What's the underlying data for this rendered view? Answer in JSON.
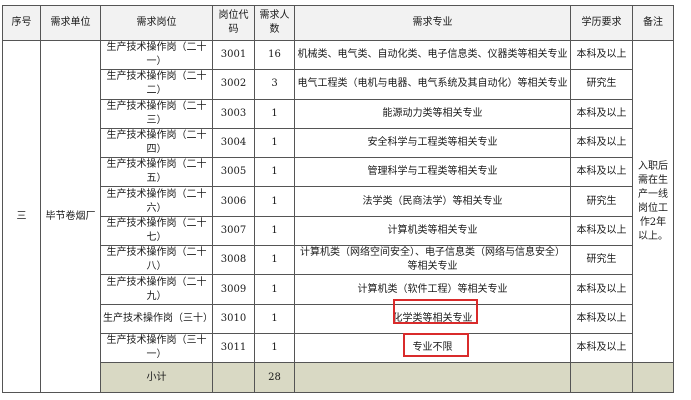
{
  "table": {
    "headers": [
      "序号",
      "需求单位",
      "需求岗位",
      "岗位代码",
      "需求人数",
      "需求专业",
      "学历要求",
      "备注"
    ],
    "seq": "三",
    "unit": "毕节卷烟厂",
    "rows": [
      {
        "post": "生产技术操作岗（二十一）",
        "code": "3001",
        "count": "16",
        "major": "机械类、电气类、自动化类、电子信息类、仪器类等相关专业",
        "edu": "本科及以上"
      },
      {
        "post": "生产技术操作岗（二十二）",
        "code": "3002",
        "count": "3",
        "major": "电气工程类（电机与电器、电气系统及其自动化）等相关专业",
        "edu": "研究生"
      },
      {
        "post": "生产技术操作岗（二十三）",
        "code": "3003",
        "count": "1",
        "major": "能源动力类等相关专业",
        "edu": "本科及以上"
      },
      {
        "post": "生产技术操作岗（二十四）",
        "code": "3004",
        "count": "1",
        "major": "安全科学与工程类等相关专业",
        "edu": "本科及以上"
      },
      {
        "post": "生产技术操作岗（二十五）",
        "code": "3005",
        "count": "1",
        "major": "管理科学与工程类等相关专业",
        "edu": "本科及以上"
      },
      {
        "post": "生产技术操作岗（二十六）",
        "code": "3006",
        "count": "1",
        "major": "法学类（民商法学）等相关专业",
        "edu": "研究生"
      },
      {
        "post": "生产技术操作岗（二十七）",
        "code": "3007",
        "count": "1",
        "major": "计算机类等相关专业",
        "edu": "本科及以上"
      },
      {
        "post": "生产技术操作岗（二十八）",
        "code": "3008",
        "count": "1",
        "major": "计算机类（网络空间安全）、电子信息类（网络与信息安全）等相关专业",
        "edu": "研究生"
      },
      {
        "post": "生产技术操作岗（二十九）",
        "code": "3009",
        "count": "1",
        "major": "计算机类（软件工程）等相关专业",
        "edu": "本科及以上"
      },
      {
        "post": "生产技术操作岗（三十）",
        "code": "3010",
        "count": "1",
        "major": "化学类等相关专业",
        "edu": "本科及以上"
      },
      {
        "post": "生产技术操作岗（三十一）",
        "code": "3011",
        "count": "1",
        "major": "专业不限",
        "edu": "本科及以上"
      }
    ],
    "note": "入职后需在生产一线岗位工作2年以上。",
    "subtotal_label": "小计",
    "subtotal_count": "28"
  },
  "highlight_color": "#d92b2b"
}
